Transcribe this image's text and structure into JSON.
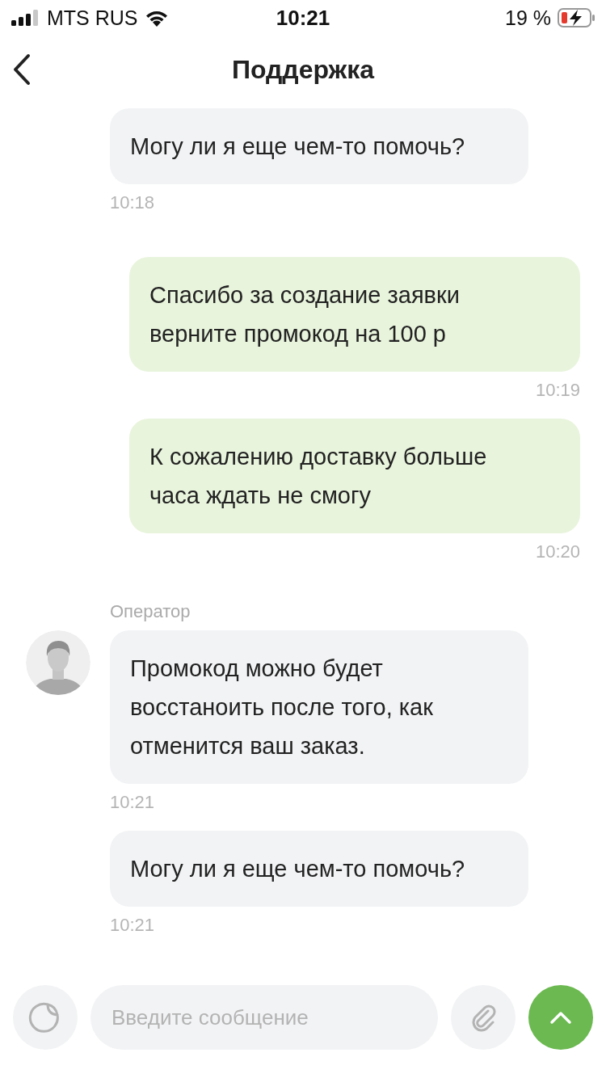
{
  "status_bar": {
    "carrier": "MTS RUS",
    "time": "10:21",
    "battery": "19 %"
  },
  "header": {
    "title": "Поддержка"
  },
  "messages": [
    {
      "kind": "incoming",
      "text": "Могу ли я еще чем-то помочь?",
      "time": "10:18"
    },
    {
      "kind": "outgoing",
      "text": "Спасибо за создание заявки верните промокод на 100 р",
      "time": "10:19"
    },
    {
      "kind": "outgoing",
      "text": "К сожалению доставку больше часа ждать не смогу",
      "time": "10:20"
    },
    {
      "kind": "incoming",
      "sender": "Оператор",
      "avatar": true,
      "text": "Промокод можно будет восстаноить после того, как отменится ваш заказ.",
      "time": "10:21"
    },
    {
      "kind": "incoming",
      "text": "Могу ли я еще чем-то помочь?",
      "time": "10:21"
    }
  ],
  "composer": {
    "placeholder": "Введите сообщение"
  }
}
